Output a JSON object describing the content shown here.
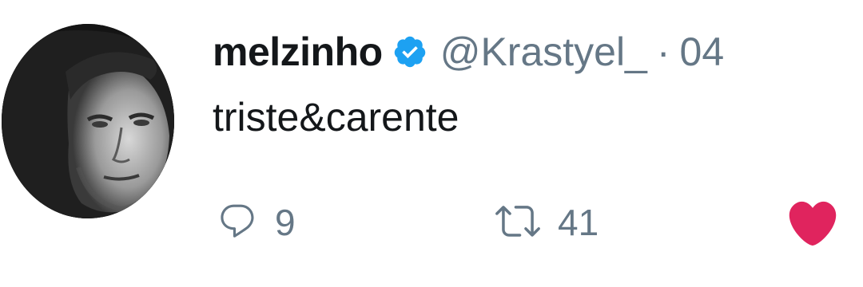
{
  "tweet": {
    "user": {
      "display_name": "melzinho",
      "handle": "@Krastyel_",
      "verified": true,
      "separator": "·",
      "time": "04"
    },
    "text": "triste&carente",
    "actions": {
      "reply_count": "9",
      "retweet_count": "41",
      "like_count": ""
    }
  },
  "colors": {
    "text": "#14171a",
    "muted": "#657786",
    "verified_blue": "#1da1f2",
    "like_red": "#e0245e"
  },
  "icons": {
    "verified": "verified-badge-icon",
    "reply": "reply-icon",
    "retweet": "retweet-icon",
    "like": "heart-icon"
  }
}
